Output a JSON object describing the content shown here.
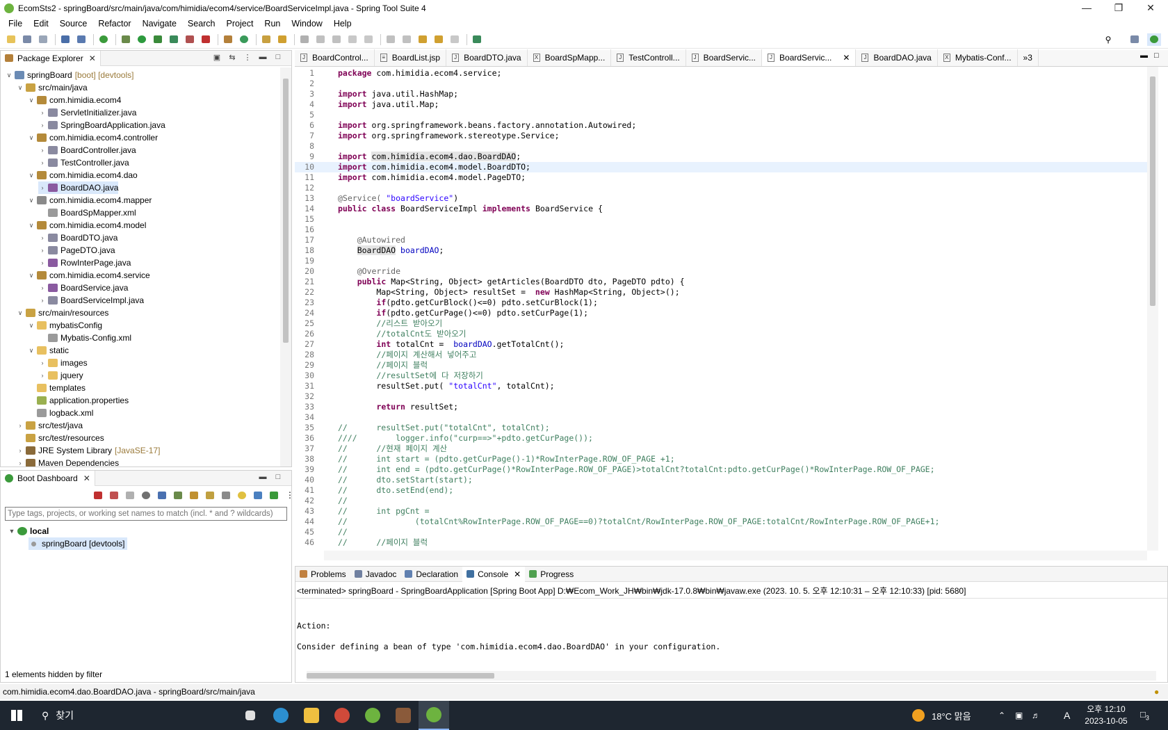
{
  "window": {
    "title": "EcomSts2 - springBoard/src/main/java/com/himidia/ecom4/service/BoardServiceImpl.java - Spring Tool Suite 4"
  },
  "menu": [
    "File",
    "Edit",
    "Source",
    "Refactor",
    "Navigate",
    "Search",
    "Project",
    "Run",
    "Window",
    "Help"
  ],
  "package_explorer": {
    "tab": "Package Explorer",
    "items": [
      {
        "label": "springBoard",
        "dec": "[boot] [devtools]",
        "depth": 0,
        "icon": "project-icon",
        "color": "#6b8bb4",
        "open": true
      },
      {
        "label": "src/main/java",
        "dec": "",
        "depth": 1,
        "icon": "source-folder-icon",
        "color": "#c9a243",
        "open": true
      },
      {
        "label": "com.himidia.ecom4",
        "dec": "",
        "depth": 2,
        "icon": "package-icon",
        "color": "#b48a3a",
        "open": true
      },
      {
        "label": "ServletInitializer.java",
        "dec": "",
        "depth": 3,
        "icon": "java-file-icon",
        "color": "#8a8aa0",
        "open": false
      },
      {
        "label": "SpringBoardApplication.java",
        "dec": "",
        "depth": 3,
        "icon": "java-file-icon",
        "color": "#8a8aa0",
        "open": false
      },
      {
        "label": "com.himidia.ecom4.controller",
        "dec": "",
        "depth": 2,
        "icon": "package-icon",
        "color": "#b48a3a",
        "open": true
      },
      {
        "label": "BoardController.java",
        "dec": "",
        "depth": 3,
        "icon": "java-file-icon",
        "color": "#8a8aa0",
        "open": false
      },
      {
        "label": "TestController.java",
        "dec": "",
        "depth": 3,
        "icon": "java-file-icon",
        "color": "#8a8aa0",
        "open": false
      },
      {
        "label": "com.himidia.ecom4.dao",
        "dec": "",
        "depth": 2,
        "icon": "package-icon",
        "color": "#b48a3a",
        "open": true
      },
      {
        "label": "BoardDAO.java",
        "dec": "",
        "depth": 3,
        "icon": "java-file-icon",
        "color": "#8a5aa0",
        "open": false,
        "selected": true
      },
      {
        "label": "com.himidia.ecom4.mapper",
        "dec": "",
        "depth": 2,
        "icon": "package-icon",
        "color": "#8a8a8a",
        "open": true
      },
      {
        "label": "BoardSpMapper.xml",
        "dec": "",
        "depth": 3,
        "icon": "xml-file-icon",
        "color": "#9a9a9a",
        "open": null
      },
      {
        "label": "com.himidia.ecom4.model",
        "dec": "",
        "depth": 2,
        "icon": "package-icon",
        "color": "#b48a3a",
        "open": true
      },
      {
        "label": "BoardDTO.java",
        "dec": "",
        "depth": 3,
        "icon": "java-file-icon",
        "color": "#8a8aa0",
        "open": false
      },
      {
        "label": "PageDTO.java",
        "dec": "",
        "depth": 3,
        "icon": "java-file-icon",
        "color": "#8a8aa0",
        "open": false
      },
      {
        "label": "RowInterPage.java",
        "dec": "",
        "depth": 3,
        "icon": "java-file-icon",
        "color": "#8a5aa0",
        "open": false
      },
      {
        "label": "com.himidia.ecom4.service",
        "dec": "",
        "depth": 2,
        "icon": "package-icon",
        "color": "#b48a3a",
        "open": true
      },
      {
        "label": "BoardService.java",
        "dec": "",
        "depth": 3,
        "icon": "java-file-icon",
        "color": "#8a5aa0",
        "open": false
      },
      {
        "label": "BoardServiceImpl.java",
        "dec": "",
        "depth": 3,
        "icon": "java-file-icon",
        "color": "#8a8aa0",
        "open": false
      },
      {
        "label": "src/main/resources",
        "dec": "",
        "depth": 1,
        "icon": "source-folder-icon",
        "color": "#c9a243",
        "open": true
      },
      {
        "label": "mybatisConfig",
        "dec": "",
        "depth": 2,
        "icon": "folder-icon",
        "color": "#e8c060",
        "open": true
      },
      {
        "label": "Mybatis-Config.xml",
        "dec": "",
        "depth": 3,
        "icon": "xml-file-icon",
        "color": "#9a9a9a",
        "open": null
      },
      {
        "label": "static",
        "dec": "",
        "depth": 2,
        "icon": "folder-icon",
        "color": "#e8c060",
        "open": true
      },
      {
        "label": "images",
        "dec": "",
        "depth": 3,
        "icon": "folder-icon",
        "color": "#e8c060",
        "open": false
      },
      {
        "label": "jquery",
        "dec": "",
        "depth": 3,
        "icon": "folder-icon",
        "color": "#e8c060",
        "open": false
      },
      {
        "label": "templates",
        "dec": "",
        "depth": 2,
        "icon": "folder-icon",
        "color": "#e8c060",
        "open": null
      },
      {
        "label": "application.properties",
        "dec": "",
        "depth": 2,
        "icon": "properties-file-icon",
        "color": "#9ab050",
        "open": null
      },
      {
        "label": "logback.xml",
        "dec": "",
        "depth": 2,
        "icon": "xml-file-icon",
        "color": "#9a9a9a",
        "open": null
      },
      {
        "label": "src/test/java",
        "dec": "",
        "depth": 1,
        "icon": "source-folder-icon",
        "color": "#c9a243",
        "open": false
      },
      {
        "label": "src/test/resources",
        "dec": "",
        "depth": 1,
        "icon": "source-folder-icon",
        "color": "#c9a243",
        "open": null
      },
      {
        "label": "JRE System Library",
        "dec": "[JavaSE-17]",
        "depth": 1,
        "icon": "library-icon",
        "color": "#8a6a3a",
        "open": false
      },
      {
        "label": "Maven Dependencies",
        "dec": "",
        "depth": 1,
        "icon": "library-icon",
        "color": "#8a6a3a",
        "open": false
      }
    ]
  },
  "boot_dashboard": {
    "tab": "Boot Dashboard",
    "filter_placeholder": "Type tags, projects, or working set names to match (incl. * and ? wildcards)",
    "local": "local",
    "app": "springBoard [devtools]",
    "hidden_note": "1 elements hidden by filter"
  },
  "editor_tabs": [
    {
      "label": "BoardControl...",
      "icon": "J"
    },
    {
      "label": "BoardList.jsp",
      "icon": "≡"
    },
    {
      "label": "BoardDTO.java",
      "icon": "J"
    },
    {
      "label": "BoardSpMapp...",
      "icon": "X"
    },
    {
      "label": "TestControll...",
      "icon": "J"
    },
    {
      "label": "BoardServic...",
      "icon": "J"
    },
    {
      "label": "BoardServic...",
      "icon": "J",
      "active": true
    },
    {
      "label": "BoardDAO.java",
      "icon": "J"
    },
    {
      "label": "Mybatis-Conf...",
      "icon": "X"
    },
    {
      "label": "»3",
      "icon": ""
    }
  ],
  "code_lines": [
    [
      [
        "kw",
        "package"
      ],
      [
        "",
        "com.himidia.ecom4.service;"
      ]
    ],
    [],
    [
      [
        "kw",
        "import"
      ],
      [
        "",
        "java.util.HashMap;"
      ]
    ],
    [
      [
        "kw",
        "import"
      ],
      [
        "",
        "java.util.Map;"
      ]
    ],
    [],
    [
      [
        "kw",
        "import"
      ],
      [
        "",
        "org.springframework.beans.factory.annotation.Autowired;"
      ]
    ],
    [
      [
        "kw",
        "import"
      ],
      [
        "",
        "org.springframework.stereotype.Service;"
      ]
    ],
    [],
    [
      [
        "kw",
        "import"
      ],
      [
        "hl",
        "com.himidia.ecom4.dao.BoardDAO"
      ],
      [
        "",
        ";"
      ]
    ],
    [
      [
        "kw",
        "import"
      ],
      [
        "",
        "com.himidia.ecom4.model.BoardDTO;"
      ]
    ],
    [
      [
        "kw",
        "import"
      ],
      [
        "",
        "com.himidia.ecom4.model.PageDTO;"
      ]
    ],
    [],
    [
      [
        "an",
        "@Service("
      ],
      [
        "st",
        "\"boardService\""
      ],
      [
        "",
        ")"
      ]
    ],
    [
      [
        "kw",
        "public class"
      ],
      [
        "",
        "BoardServiceImpl"
      ],
      [
        "kw",
        "implements"
      ],
      [
        "",
        "BoardService {"
      ]
    ],
    [],
    [],
    [
      [
        "",
        "    "
      ],
      [
        "an",
        "@Autowired"
      ]
    ],
    [
      [
        "",
        "    "
      ],
      [
        "hl",
        "BoardDAO"
      ],
      [
        "fd",
        "boardDAO"
      ],
      [
        "",
        ";"
      ]
    ],
    [],
    [
      [
        "",
        "    "
      ],
      [
        "an",
        "@Override"
      ]
    ],
    [
      [
        "",
        "    "
      ],
      [
        "kw",
        "public"
      ],
      [
        "",
        "Map<String, Object> getArticles(BoardDTO dto, PageDTO pdto) {"
      ]
    ],
    [
      [
        "",
        "        Map<String, Object> resultSet = "
      ],
      [
        "kw",
        "new"
      ],
      [
        "",
        "HashMap<String, Object>();"
      ]
    ],
    [
      [
        "",
        "        "
      ],
      [
        "kw",
        "if"
      ],
      [
        "",
        "(pdto.getCurBlock()<=0) pdto.setCurBlock(1);"
      ]
    ],
    [
      [
        "",
        "        "
      ],
      [
        "kw",
        "if"
      ],
      [
        "",
        "(pdto.getCurPage()<=0) pdto.setCurPage(1);"
      ]
    ],
    [
      [
        "",
        "        "
      ],
      [
        "cm",
        "//리스트 받아오기"
      ]
    ],
    [
      [
        "",
        "        "
      ],
      [
        "cm",
        "//totalCnt도 받아오기"
      ]
    ],
    [
      [
        "",
        "        "
      ],
      [
        "kw",
        "int"
      ],
      [
        "",
        "totalCnt = "
      ],
      [
        "fd",
        "boardDAO"
      ],
      [
        "",
        ".getTotalCnt();"
      ]
    ],
    [
      [
        "",
        "        "
      ],
      [
        "cm",
        "//페이지 계산해서 넣어주고"
      ]
    ],
    [
      [
        "",
        "        "
      ],
      [
        "cm",
        "//페이지 블럭"
      ]
    ],
    [
      [
        "",
        "        "
      ],
      [
        "cm",
        "//resultSet에 다 저장하기"
      ]
    ],
    [
      [
        "",
        "        resultSet.put("
      ],
      [
        "st",
        "\"totalCnt\""
      ],
      [
        "",
        ", totalCnt);"
      ]
    ],
    [],
    [
      [
        "",
        "        "
      ],
      [
        "kw",
        "return"
      ],
      [
        "",
        "resultSet;"
      ]
    ],
    [],
    [
      [
        "cm",
        "//      resultSet.put(\"totalCnt\", totalCnt);"
      ]
    ],
    [
      [
        "cm",
        "////        logger.info(\"curp==>\"+pdto.getCurPage());"
      ]
    ],
    [
      [
        "cm",
        "//      //현재 페이지 계산"
      ]
    ],
    [
      [
        "cm",
        "//      int start = (pdto.getCurPage()-1)*RowInterPage.ROW_OF_PAGE +1;"
      ]
    ],
    [
      [
        "cm",
        "//      int end = (pdto.getCurPage()*RowInterPage.ROW_OF_PAGE)>totalCnt?totalCnt:pdto.getCurPage()*RowInterPage.ROW_OF_PAGE;"
      ]
    ],
    [
      [
        "cm",
        "//      dto.setStart(start);"
      ]
    ],
    [
      [
        "cm",
        "//      dto.setEnd(end);"
      ]
    ],
    [
      [
        "cm",
        "//"
      ]
    ],
    [
      [
        "cm",
        "//      int pgCnt ="
      ]
    ],
    [
      [
        "cm",
        "//              (totalCnt%RowInterPage.ROW_OF_PAGE==0)?totalCnt/RowInterPage.ROW_OF_PAGE:totalCnt/RowInterPage.ROW_OF_PAGE+1;"
      ]
    ],
    [
      [
        "cm",
        "//"
      ]
    ],
    [
      [
        "cm",
        "//      //페이지 블럭"
      ]
    ]
  ],
  "bottom_tabs": [
    {
      "label": "Problems",
      "icon": "problems-icon",
      "color": "#c08040"
    },
    {
      "label": "Javadoc",
      "icon": "javadoc-icon",
      "color": "#7080a0"
    },
    {
      "label": "Declaration",
      "icon": "declaration-icon",
      "color": "#6080b0"
    },
    {
      "label": "Console",
      "icon": "console-icon",
      "color": "#4070a0",
      "active": true
    },
    {
      "label": "Progress",
      "icon": "progress-icon",
      "color": "#50a050"
    }
  ],
  "console": {
    "header": "<terminated> springBoard - SpringBoardApplication [Spring Boot App] D:₩Ecom_Work_JH₩bin₩jdk-17.0.8₩bin₩javaw.exe  (2023. 10. 5. 오후 12:10:31 – 오후 12:10:33) [pid: 5680]",
    "lines": [
      "",
      "",
      "Action:",
      "",
      "Consider defining a bean of type 'com.himidia.ecom4.dao.BoardDAO' in your configuration."
    ]
  },
  "status": {
    "text": "com.himidia.ecom4.dao.BoardDAO.java - springBoard/src/main/java"
  },
  "taskbar": {
    "search": "찾기",
    "weather": "18°C  맑음",
    "time": "오후 12:10",
    "date": "2023-10-05",
    "notifications": "3",
    "ime": "A"
  }
}
